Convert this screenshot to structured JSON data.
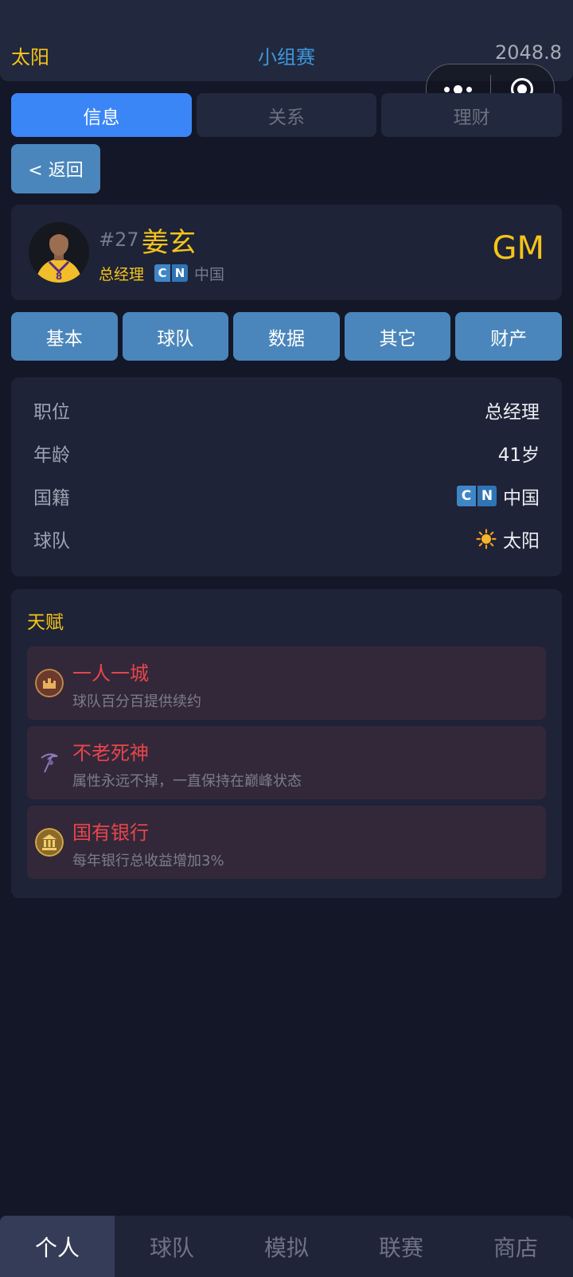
{
  "header": {
    "team": "太阳",
    "stage": "小组赛",
    "money": "2048.8"
  },
  "tabs": [
    {
      "label": "信息",
      "active": true
    },
    {
      "label": "关系",
      "active": false
    },
    {
      "label": "理财",
      "active": false
    }
  ],
  "back_label": "< 返回",
  "profile": {
    "number": "#27",
    "name": "姜玄",
    "role": "总经理",
    "flag_letters": [
      "C",
      "N"
    ],
    "country": "中国",
    "badge": "GM"
  },
  "subtabs": [
    "基本",
    "球队",
    "数据",
    "其它",
    "财产"
  ],
  "info_rows": [
    {
      "key": "职位",
      "value": "总经理"
    },
    {
      "key": "年龄",
      "value": "41岁"
    },
    {
      "key": "国籍",
      "value": "中国",
      "icon": "cn-flag"
    },
    {
      "key": "球队",
      "value": "太阳",
      "icon": "sun-icon"
    }
  ],
  "talents": {
    "title": "天赋",
    "items": [
      {
        "name": "一人一城",
        "desc": "球队百分百提供续约",
        "icon": "castle-emblem-icon"
      },
      {
        "name": "不老死神",
        "desc": "属性永远不掉，一直保持在巅峰状态",
        "icon": "reaper-icon"
      },
      {
        "name": "国有银行",
        "desc": "每年银行总收益增加3%",
        "icon": "bank-emblem-icon"
      }
    ]
  },
  "bottom_nav": [
    {
      "label": "个人",
      "active": true
    },
    {
      "label": "球队",
      "active": false
    },
    {
      "label": "模拟",
      "active": false
    },
    {
      "label": "联赛",
      "active": false
    },
    {
      "label": "商店",
      "active": false
    }
  ],
  "colors": {
    "accent_yellow": "#f5c419",
    "accent_blue": "#3b86f7",
    "button_blue": "#4a86bb",
    "talent_red": "#e8454b"
  }
}
